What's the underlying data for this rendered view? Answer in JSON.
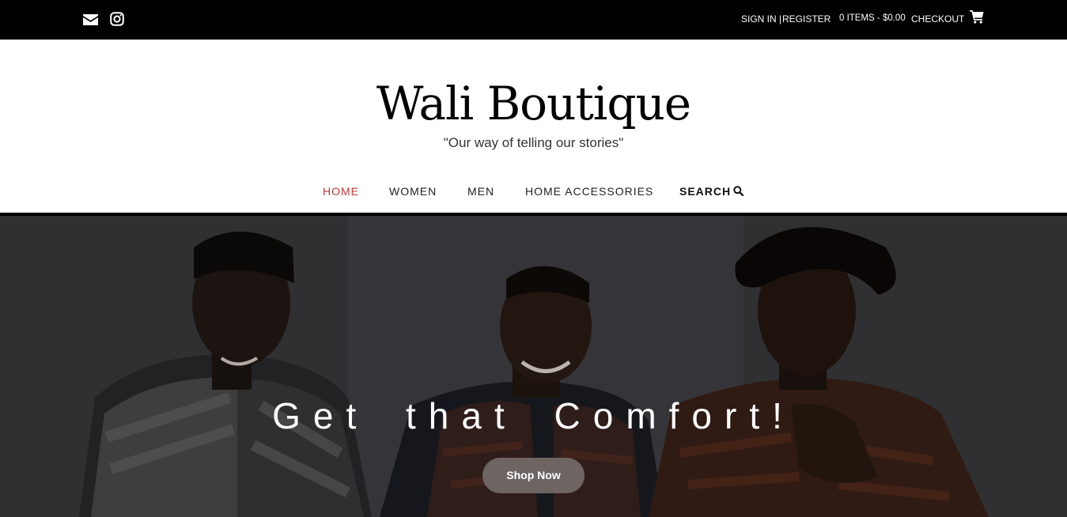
{
  "topbar": {
    "icons": [
      "envelope-icon",
      "instagram-icon",
      "shopping-cart-icon"
    ],
    "sign_in": "SIGN IN",
    "separator": "|",
    "register": "REGISTER",
    "cart_summary": "0 ITEMS - $0.00",
    "checkout": "CHECKOUT"
  },
  "header": {
    "site_title": "Wali Boutique",
    "tagline": "\"Our way of telling our stories\""
  },
  "nav": {
    "items": [
      {
        "label": "HOME",
        "active": true
      },
      {
        "label": "WOMEN"
      },
      {
        "label": "MEN"
      },
      {
        "label": "HOME ACCESSORIES"
      }
    ],
    "search_label": "SEARCH"
  },
  "hero": {
    "heading": "Get that Comfort!",
    "button_label": "Shop Now"
  },
  "colors": {
    "topbar_bg": "#000000",
    "active_nav": "#b53a3a",
    "button_bg": "#6e6462",
    "hero_overlay": "#3a3a3d"
  }
}
